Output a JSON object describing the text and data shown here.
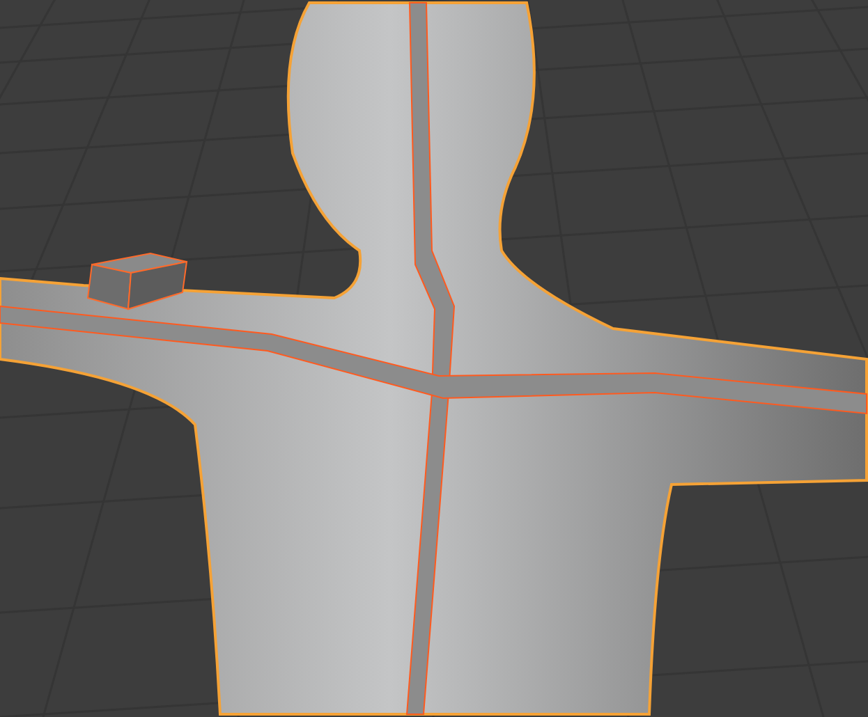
{
  "viewport": {
    "objects": [
      {
        "kind": "mannequin",
        "selected": true
      },
      {
        "kind": "box",
        "selected": true
      }
    ]
  }
}
